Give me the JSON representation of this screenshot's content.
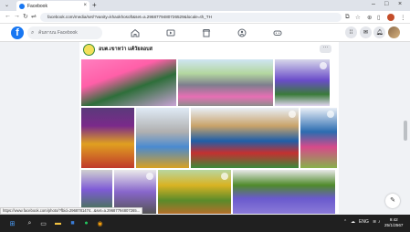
{
  "browser": {
    "tab_title": "Facebook",
    "new_tab": "+",
    "tab_close": "×",
    "win_min": "–",
    "win_max": "□",
    "win_close": "×",
    "url": "facebook.com/media/set/?vanity=khaokhosoft&set=a.2968779480726529&locale=th_TH"
  },
  "facebook": {
    "logo": "f",
    "search_placeholder": "ค้นหาบน Facebook",
    "nav_icons": [
      "home-icon",
      "video-icon",
      "marketplace-icon",
      "groups-icon",
      "gaming-icon"
    ],
    "right_icons": [
      "menu-grid-icon",
      "messenger-icon",
      "notifications-icon",
      "account-avatar"
    ]
  },
  "page": {
    "name": "อบต.เขาหว่า แค้วัยลอบส",
    "more": "···"
  },
  "photos": [
    {
      "theme": "students-selfie",
      "colors": [
        "#ff5fa8",
        "#2e6e3a",
        "#c9a3d6"
      ]
    },
    {
      "theme": "parade-street",
      "colors": [
        "#e76fb4",
        "#8d8d8d",
        "#c2c2c2"
      ]
    },
    {
      "theme": "parade-purple",
      "colors": [
        "#6a4cc9",
        "#d7d7ea",
        "#3a7b3a"
      ]
    },
    {
      "theme": "stage-performance",
      "colors": [
        "#7a2a8a",
        "#e0a020",
        "#5a3a7a"
      ]
    },
    {
      "theme": "float-decoration",
      "colors": [
        "#c0392b",
        "#e3b84a",
        "#7b4ea0"
      ]
    },
    {
      "theme": "street-procession",
      "colors": [
        "#b0b0b0",
        "#4a8ad0",
        "#d7a021"
      ]
    },
    {
      "theme": "temple-crowd",
      "colors": [
        "#1f5fa8",
        "#c43030",
        "#3b8a3b"
      ]
    },
    {
      "theme": "dancers-blue",
      "colors": [
        "#2b6cb0",
        "#d64a8a",
        "#88b04b"
      ]
    },
    {
      "theme": "children-purple",
      "colors": [
        "#7e5bd6",
        "#d0d0d0",
        "#3c7a3c"
      ]
    },
    {
      "theme": "group-photo",
      "colors": [
        "#8866cc",
        "#eaeaea",
        "#555555"
      ]
    },
    {
      "theme": "gold-float",
      "colors": [
        "#d9b323",
        "#5a8a2a",
        "#b56f2a"
      ]
    },
    {
      "theme": "procession-trees",
      "colors": [
        "#6a5acd",
        "#4f8a2a",
        "#e8e8e8"
      ]
    }
  ],
  "status_bar_url": "https://www.facebook.com/photo/?fbid=2968781474...&set=a.29687794807265...",
  "taskbar": {
    "time": "9:42",
    "date": "25/1/2567",
    "lang": "ENG"
  }
}
